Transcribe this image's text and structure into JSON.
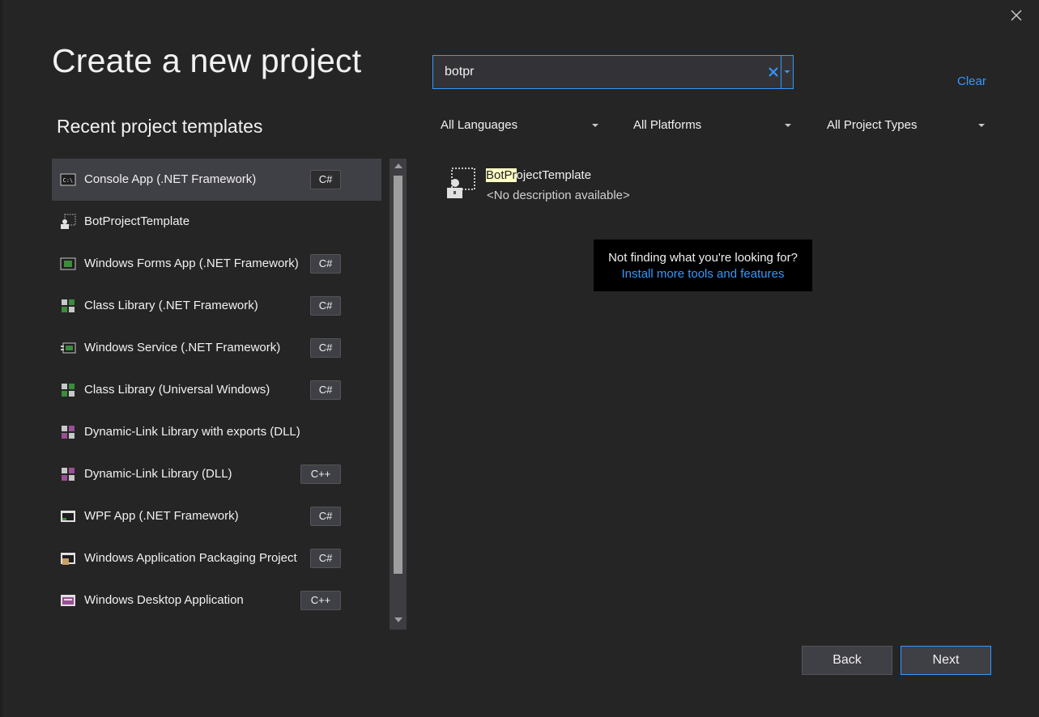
{
  "page": {
    "title": "Create a new project"
  },
  "search": {
    "value": "botpr",
    "clear_label": "Clear"
  },
  "filters": [
    {
      "label": "All Languages"
    },
    {
      "label": "All Platforms"
    },
    {
      "label": "All Project Types"
    }
  ],
  "recent": {
    "title": "Recent project templates",
    "items": [
      {
        "name": "Console App (.NET Framework)",
        "tag": "C#",
        "icon": "console-app-icon"
      },
      {
        "name": "BotProjectTemplate",
        "tag": "",
        "icon": "bot-template-icon"
      },
      {
        "name": "Windows Forms App (.NET Framework)",
        "tag": "C#",
        "icon": "windows-forms-icon"
      },
      {
        "name": "Class Library (.NET Framework)",
        "tag": "C#",
        "icon": "class-library-icon"
      },
      {
        "name": "Windows Service (.NET Framework)",
        "tag": "C#",
        "icon": "windows-service-icon"
      },
      {
        "name": "Class Library (Universal Windows)",
        "tag": "C#",
        "icon": "class-library-uwp-icon"
      },
      {
        "name": "Dynamic-Link Library with exports (DLL)",
        "tag": "",
        "icon": "dll-exports-icon"
      },
      {
        "name": "Dynamic-Link Library (DLL)",
        "tag": "C++",
        "icon": "dll-icon"
      },
      {
        "name": "WPF App (.NET Framework)",
        "tag": "C#",
        "icon": "wpf-app-icon"
      },
      {
        "name": "Windows Application Packaging Project",
        "tag": "C#",
        "icon": "packaging-project-icon"
      },
      {
        "name": "Windows Desktop Application",
        "tag": "C++",
        "icon": "desktop-app-icon"
      }
    ]
  },
  "results": [
    {
      "name_highlight": "BotPr",
      "name_rest": "ojectTemplate",
      "description": "<No description available>"
    }
  ],
  "not_finding": {
    "question": "Not finding what you're looking for?",
    "link": "Install more tools and features"
  },
  "buttons": {
    "back": "Back",
    "next": "Next"
  },
  "colors": {
    "background": "#252526",
    "accent": "#3399ff",
    "selected": "#3f3f46",
    "highlight": "#fffdc5"
  }
}
